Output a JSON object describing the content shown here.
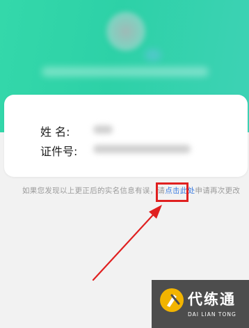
{
  "form": {
    "name_label": "姓    名:",
    "id_label": "证件号:"
  },
  "hint": {
    "prefix": "如果您发现以上更正后的实名信息有误，请",
    "link": "点击此处",
    "suffix": "申请再次更改"
  },
  "watermark": {
    "cn": "代练通",
    "en": "DAI LIAN TONG"
  },
  "colors": {
    "header_gradient": "#34d8aa",
    "link": "#3a7be0",
    "highlight": "#e02020",
    "logo_bg": "#4d4d4d",
    "logo_accent": "#f2b400"
  }
}
